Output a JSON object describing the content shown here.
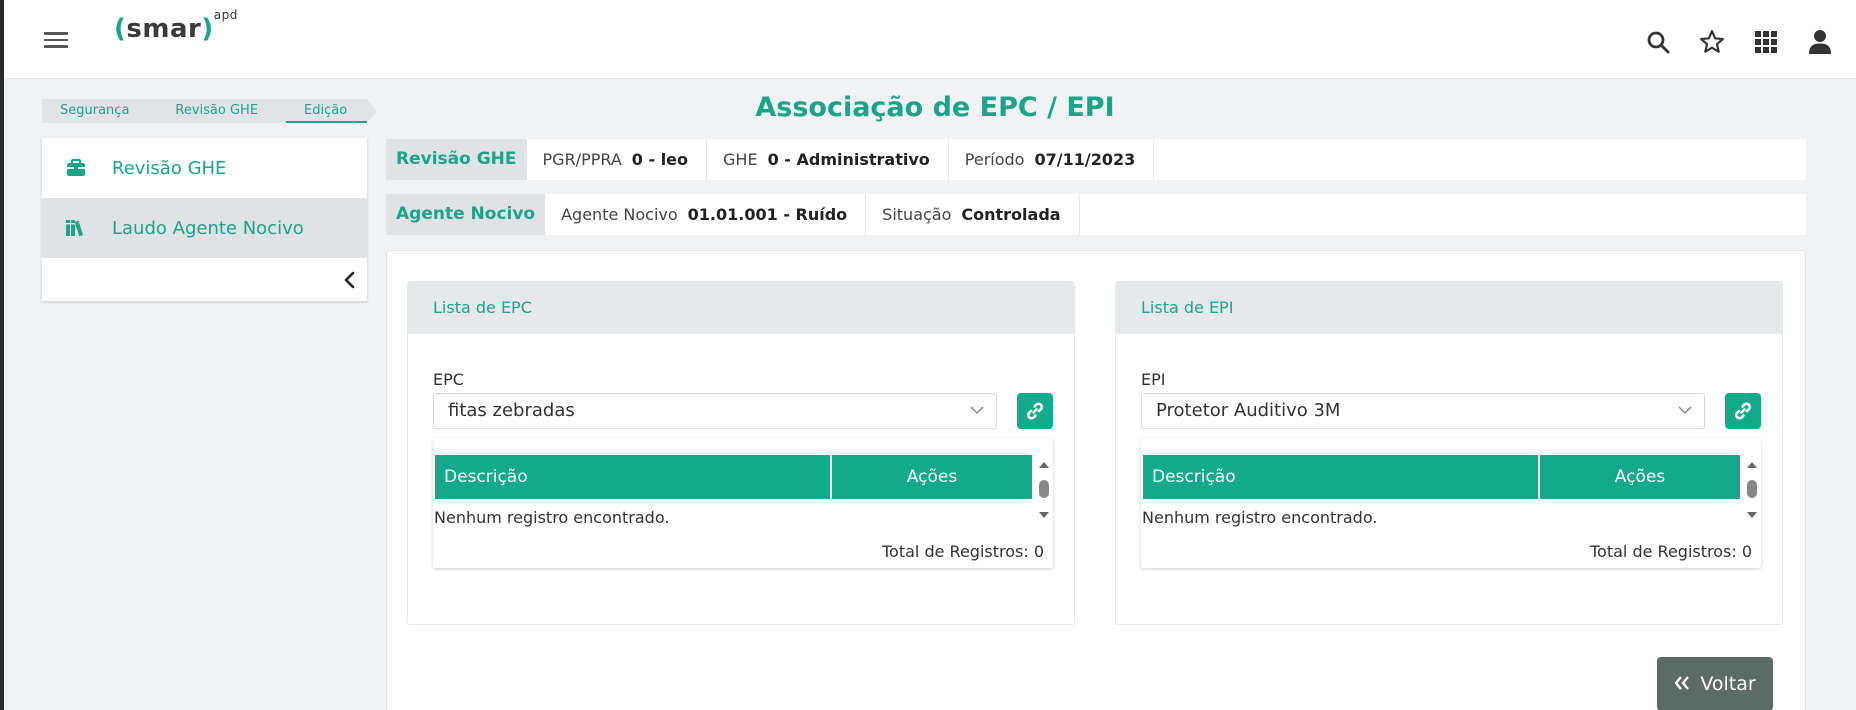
{
  "header": {
    "logo_text": "smar",
    "logo_suffix": "apd"
  },
  "breadcrumb": [
    {
      "label": "Segurança"
    },
    {
      "label": "Revisão GHE"
    },
    {
      "label": "Edição"
    }
  ],
  "page_title": "Associação de EPC / EPI",
  "sidebar": {
    "items": [
      {
        "label": "Revisão GHE",
        "icon": "briefcase-icon"
      },
      {
        "label": "Laudo Agente Nocivo",
        "icon": "books-icon"
      }
    ]
  },
  "revisao_bar": {
    "badge": "Revisão GHE",
    "fields": [
      {
        "label": "PGR/PPRA",
        "value": "0 - leo"
      },
      {
        "label": "GHE",
        "value": "0 - Administrativo"
      },
      {
        "label": "Período",
        "value": "07/11/2023"
      }
    ]
  },
  "agente_bar": {
    "badge": "Agente Nocivo",
    "fields": [
      {
        "label": "Agente Nocivo",
        "value": "01.01.001 - Ruído"
      },
      {
        "label": "Situação",
        "value": "Controlada"
      }
    ]
  },
  "epc": {
    "title": "Lista de EPC",
    "field_label": "EPC",
    "selected": "fitas zebradas",
    "col_desc": "Descrição",
    "col_actions": "Ações",
    "empty": "Nenhum registro encontrado.",
    "total": "Total de Registros: 0"
  },
  "epi": {
    "title": "Lista de EPI",
    "field_label": "EPI",
    "selected": "Protetor Auditivo 3M",
    "col_desc": "Descrição",
    "col_actions": "Ações",
    "empty": "Nenhum registro encontrado.",
    "total": "Total de Registros: 0"
  },
  "voltar_label": "Voltar",
  "colors": {
    "accent": "#12aa8a",
    "back_button": "#5d6b67"
  }
}
